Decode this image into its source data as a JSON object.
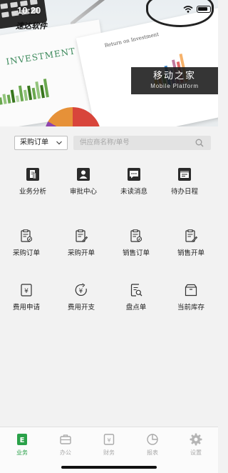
{
  "status_bar": {
    "time": "10:20"
  },
  "banner": {
    "brand": "速达软件",
    "doc_title_left": "INVESTMENT",
    "doc_title_right": "Return on Investment",
    "overlay_title": "移动之家",
    "overlay_subtitle": "Mobile Platform"
  },
  "search": {
    "type_selected": "采购订单",
    "placeholder": "供应商名称/单号"
  },
  "colors": {
    "accent": "#2aa149",
    "icon_dark": "#2b2b2b",
    "tab_inactive": "#a9a9a9"
  },
  "grid": {
    "row1": [
      {
        "label": "业务分析",
        "icon": "business-analysis-icon"
      },
      {
        "label": "审批中心",
        "icon": "approval-center-icon"
      },
      {
        "label": "未读消息",
        "icon": "unread-message-icon"
      },
      {
        "label": "待办日程",
        "icon": "todo-schedule-icon"
      }
    ],
    "row2": [
      {
        "label": "采购订单",
        "icon": "purchase-order-icon"
      },
      {
        "label": "采购开单",
        "icon": "purchase-billing-icon"
      },
      {
        "label": "销售订单",
        "icon": "sales-order-icon"
      },
      {
        "label": "销售开单",
        "icon": "sales-billing-icon"
      }
    ],
    "row3": [
      {
        "label": "费用申请",
        "icon": "expense-request-icon"
      },
      {
        "label": "费用开支",
        "icon": "expense-payment-icon"
      },
      {
        "label": "盘点单",
        "icon": "stocktake-icon"
      },
      {
        "label": "当前库存",
        "icon": "current-stock-icon"
      }
    ]
  },
  "tabs": [
    {
      "label": "业务",
      "icon": "business-tab-icon",
      "active": true
    },
    {
      "label": "办公",
      "icon": "briefcase-icon",
      "active": false
    },
    {
      "label": "财务",
      "icon": "finance-icon",
      "active": false
    },
    {
      "label": "报表",
      "icon": "pie-chart-icon",
      "active": false
    },
    {
      "label": "设置",
      "icon": "gear-icon",
      "active": false
    }
  ]
}
